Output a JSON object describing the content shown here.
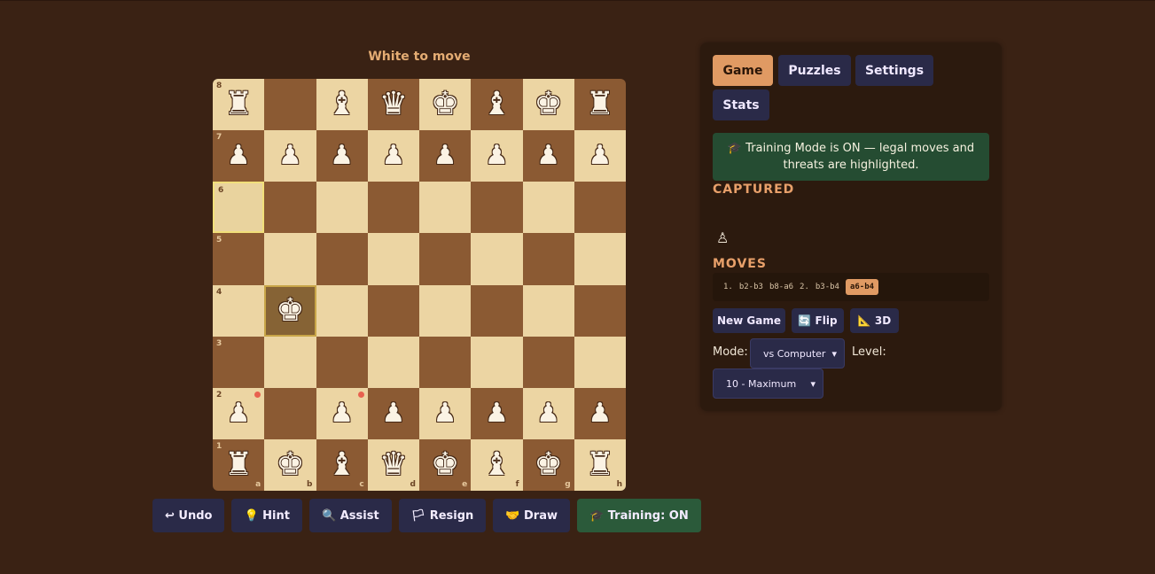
{
  "status": {
    "turn_text": "White to move"
  },
  "board": {
    "ranks": [
      "8",
      "7",
      "6",
      "5",
      "4",
      "3",
      "2",
      "1"
    ],
    "files": [
      "a",
      "b",
      "c",
      "d",
      "e",
      "f",
      "g",
      "h"
    ],
    "squares": [
      [
        "♜",
        "",
        "♝",
        "♛",
        "♚",
        "♝",
        "♚",
        "♜"
      ],
      [
        "♟",
        "♟",
        "♟",
        "♟",
        "♟",
        "♟",
        "♟",
        "♟"
      ],
      [
        "",
        "",
        "",
        "",
        "",
        "",
        "",
        ""
      ],
      [
        "",
        "",
        "",
        "",
        "",
        "",
        "",
        ""
      ],
      [
        "",
        "♚",
        "",
        "",
        "",
        "",
        "",
        ""
      ],
      [
        "",
        "",
        "",
        "",
        "",
        "",
        "",
        ""
      ],
      [
        "♟",
        "",
        "♟",
        "♟",
        "♟",
        "♟",
        "♟",
        "♟"
      ],
      [
        "♜",
        "♚",
        "♝",
        "♛",
        "♚",
        "♝",
        "♚",
        "♜"
      ]
    ],
    "highlight_selected": "a6",
    "highlight_king": "b4",
    "threats": [
      "a2",
      "c2"
    ]
  },
  "controls": {
    "undo": "↩ Undo",
    "hint": "💡 Hint",
    "assist": "🔍 Assist",
    "resign": "🏳 Resign",
    "draw": "🤝 Draw",
    "training": "🎓 Training: ON"
  },
  "panel": {
    "tabs": [
      "Game",
      "Puzzles",
      "Settings",
      "Stats"
    ],
    "active_tab": "Game",
    "banner": "🎓 Training Mode is ON — legal moves and threats are highlighted.",
    "captured_heading": "CAPTURED",
    "captured": "♙",
    "moves_heading": "MOVES",
    "moves": [
      "1.",
      "b2-b3",
      "b8-a6",
      "2.",
      "b3-b4",
      "a6-b4"
    ],
    "new_game": "New Game",
    "flip": "🔄 Flip",
    "three_d": "📐 3D",
    "mode_label": "Mode:",
    "mode_value": "vs Computer",
    "level_label": "Level:",
    "level_value": "10 - Maximum"
  }
}
